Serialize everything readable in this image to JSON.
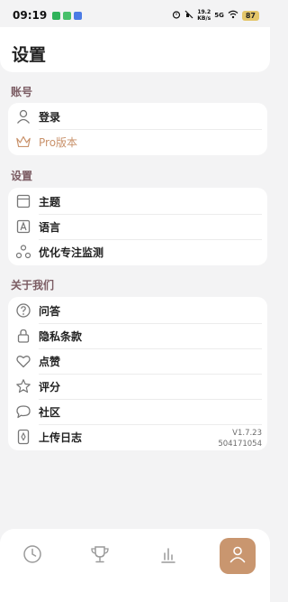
{
  "status_bar": {
    "time": "09:19",
    "speed_value": "19.2",
    "speed_unit": "KB/s",
    "network": "5G",
    "battery": "87"
  },
  "page": {
    "title": "设置"
  },
  "sections": {
    "account": {
      "label": "账号",
      "items": [
        {
          "label": "登录",
          "icon": "person-icon"
        },
        {
          "label": "Pro版本",
          "icon": "crown-icon"
        }
      ]
    },
    "settings": {
      "label": "设置",
      "items": [
        {
          "label": "主题",
          "icon": "theme-icon"
        },
        {
          "label": "语言",
          "icon": "language-icon"
        },
        {
          "label": "优化专注监测",
          "icon": "optimize-icon"
        }
      ]
    },
    "about": {
      "label": "关于我们",
      "items": [
        {
          "label": "问答",
          "icon": "question-icon"
        },
        {
          "label": "隐私条款",
          "icon": "lock-icon"
        },
        {
          "label": "点赞",
          "icon": "heart-icon"
        },
        {
          "label": "评分",
          "icon": "star-icon"
        },
        {
          "label": "社区",
          "icon": "chat-icon"
        },
        {
          "label": "上传日志",
          "icon": "upload-log-icon"
        }
      ],
      "version": "V1.7.23",
      "build": "504171054"
    }
  },
  "bottom_nav": {
    "items": [
      {
        "name": "timer",
        "icon": "clock-icon"
      },
      {
        "name": "achievements",
        "icon": "trophy-icon"
      },
      {
        "name": "statistics",
        "icon": "bar-chart-icon"
      },
      {
        "name": "profile",
        "icon": "person-icon",
        "active": true
      }
    ]
  },
  "colors": {
    "accent": "#c9966f",
    "section_label": "#7b5c63",
    "background": "#f3f3f4"
  }
}
